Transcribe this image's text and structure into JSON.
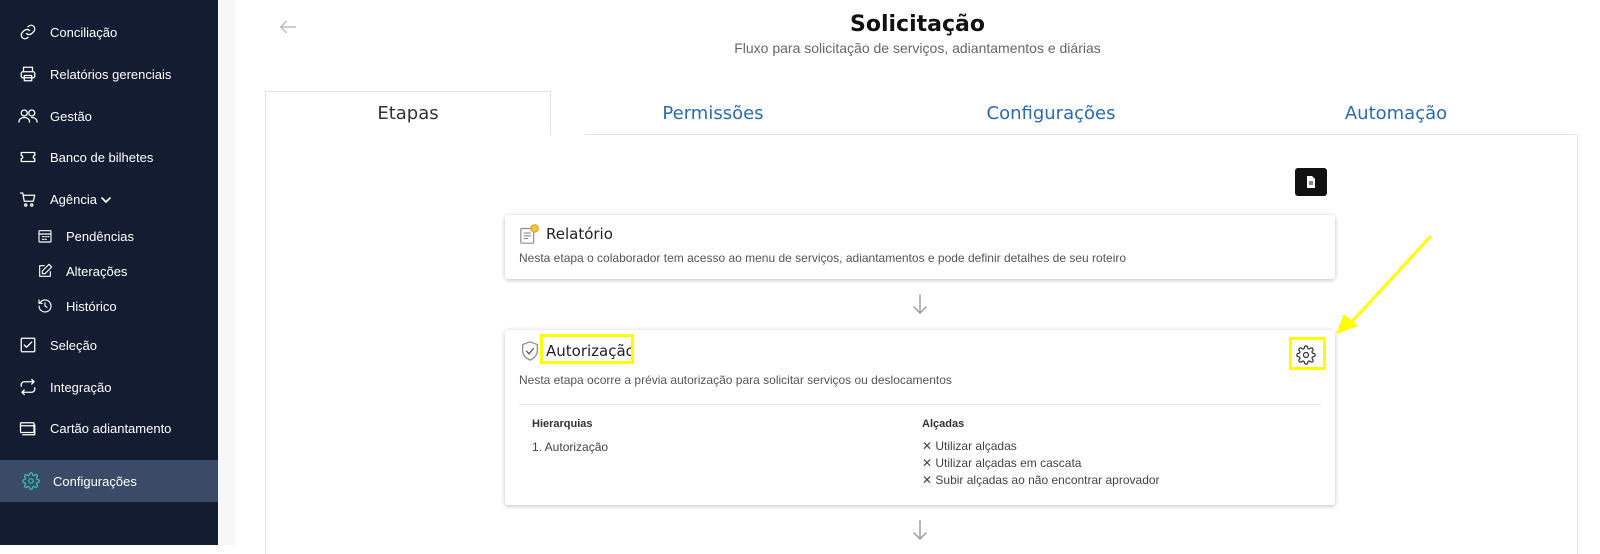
{
  "sidebar": {
    "items": [
      {
        "label": "Conciliação",
        "icon": "link-icon"
      },
      {
        "label": "Relatórios gerenciais",
        "icon": "printer-icon"
      },
      {
        "label": "Gestão",
        "icon": "users-icon"
      },
      {
        "label": "Banco de bilhetes",
        "icon": "ticket-icon"
      },
      {
        "label": "Agência",
        "icon": "cart-icon"
      },
      {
        "label": "Pendências",
        "icon": "calendar-icon"
      },
      {
        "label": "Alterações",
        "icon": "edit-icon"
      },
      {
        "label": "Histórico",
        "icon": "history-icon"
      },
      {
        "label": "Seleção",
        "icon": "checkbox-icon"
      },
      {
        "label": "Integração",
        "icon": "repeat-icon"
      },
      {
        "label": "Cartão adiantamento",
        "icon": "card-icon"
      },
      {
        "label": "Configurações",
        "icon": "gear-icon"
      }
    ],
    "active": "Configurações",
    "accent": "#2bc4b0"
  },
  "header": {
    "title": "Solicitação",
    "subtitle": "Fluxo para solicitação de serviços, adiantamentos e diárias"
  },
  "tabs": [
    "Etapas",
    "Permissões",
    "Configurações",
    "Automação"
  ],
  "steps": {
    "relatorio": {
      "title": "Relatório",
      "description": "Nesta etapa o colaborador tem acesso ao menu de serviços, adiantamentos e pode definir detalhes de seu roteiro"
    },
    "autorizacao": {
      "title": "Autorização",
      "description": "Nesta etapa ocorre a prévia autorização para solicitar serviços ou deslocamentos",
      "hierarquias_label": "Hierarquias",
      "hierarquias": [
        "1. Autorização"
      ],
      "alcadas_label": "Alçadas",
      "alcadas": [
        "Utilizar alçadas",
        "Utilizar alçadas em cascata",
        "Subir alçadas ao não encontrar aprovador"
      ]
    }
  },
  "colors": {
    "highlight": "#ffff00",
    "tab_link": "#2a6bb0",
    "sidebar_bg": "#131c30"
  }
}
